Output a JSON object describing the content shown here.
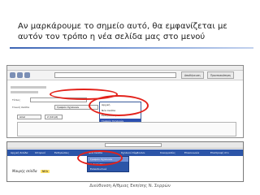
{
  "slide": {
    "title": "Αν μαρκάρουμε το σημείο αυτό, θα εμφανίζεται με αυτόν τον τρόπο η νέα σελίδα μας στο μενού",
    "footer": "Διεύθυνση Α/θμιας Εκπ/σης Ν. Σερρών"
  },
  "screenshot1": {
    "tabs": [
      "Αποθήκευση",
      "Προεπισκόπηση"
    ],
    "fields": {
      "title_label": "Τίτλος",
      "parent_label": "Γονική σελίδα",
      "parent_value": "Γραφείο Σχολικών",
      "format_value": "Arial",
      "size_value": "2 (10 pt)"
    },
    "dropdown_items": [
      "Αρχική",
      "Νέα σελίδα",
      "Εκδηλώσεις",
      "Γραφείο Σχολικών",
      "Σχολικοί Σύμβουλοι",
      "Εκπαιδευτικά",
      "Συνεργασίες"
    ],
    "dropdown_selected_index": 3
  },
  "screenshot2": {
    "nav_items": [
      "Αρχική Σελίδα",
      "Ιστορικό",
      "Εκδηλώσεις",
      "Προκηρύξεις",
      "Νέα σελίδα",
      "Σχολικοί Σύμβουλοι",
      "Συνεργασίες",
      "Επικοινωνία",
      "Επιστροφή στο",
      "Εκτύπωση"
    ],
    "submenu_items": [
      "Γραφείο Σχολικών",
      "Εκδηλώσεις",
      "Εκπαιδευτικά",
      "Σχολικοί Σύμβουλοι",
      "Συνεργασίες"
    ],
    "submenu_selected_index": 0,
    "page_header": "Μαυρής σελίδα",
    "badge": "ΝΕΑ"
  },
  "colors": {
    "highlight_red": "#e3221b",
    "nav_blue": "#2c55a8",
    "title_rule": "#3c64b4"
  }
}
